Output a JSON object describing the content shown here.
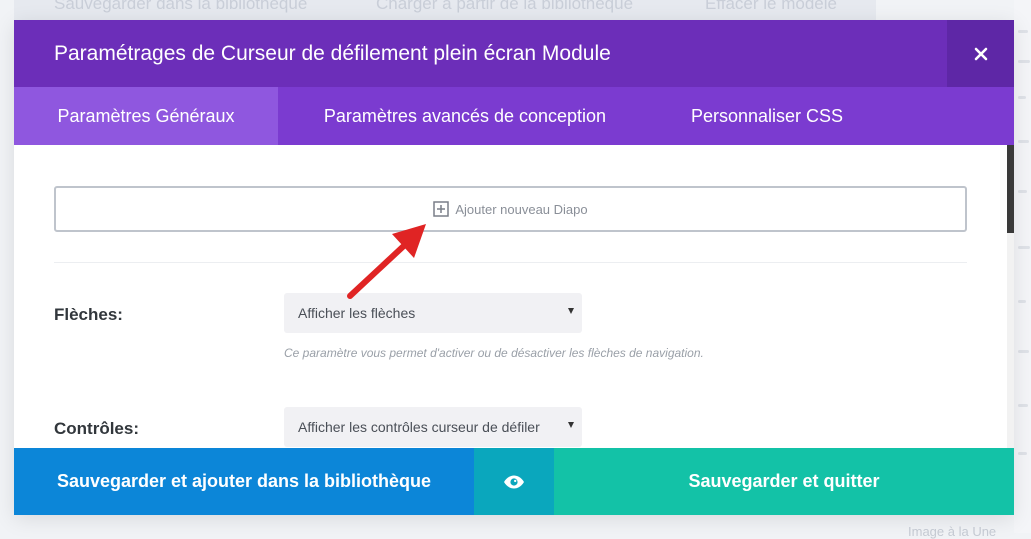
{
  "background": {
    "top_actions": [
      "Sauvegarder dans la bibliothèque",
      "Charger à partir de la bibliothèque",
      "Effacer le modèle"
    ],
    "bottom_right_text": "Image à la Une"
  },
  "modal": {
    "title": "Paramétrages de Curseur de défilement plein écran Module",
    "close_icon": "close-icon",
    "tabs": [
      {
        "label": "Paramètres Généraux",
        "active": true
      },
      {
        "label": "Paramètres avancés de conception",
        "active": false
      },
      {
        "label": "Personnaliser CSS",
        "active": false
      }
    ],
    "add_slide_label": "Ajouter nouveau Diapo",
    "fields": {
      "arrows": {
        "label": "Flèches:",
        "value": "Afficher les flèches",
        "help": "Ce paramètre vous permet d'activer ou de désactiver les flèches de navigation."
      },
      "controls": {
        "label": "Contrôles:",
        "value": "Afficher les contrôles curseur de défiler"
      }
    },
    "footer": {
      "save_library_label": "Sauvegarder et ajouter dans la bibliothèque",
      "preview_icon": "eye-icon",
      "save_quit_label": "Sauvegarder et quitter"
    }
  },
  "colors": {
    "header": "#6c2eb9",
    "tabs": "#7b3bd0",
    "active_tab": "#8f57df",
    "save_library": "#0c86d8",
    "preview": "#0aa7bd",
    "save_quit": "#13c2a7",
    "annotation_arrow": "#e02424"
  }
}
